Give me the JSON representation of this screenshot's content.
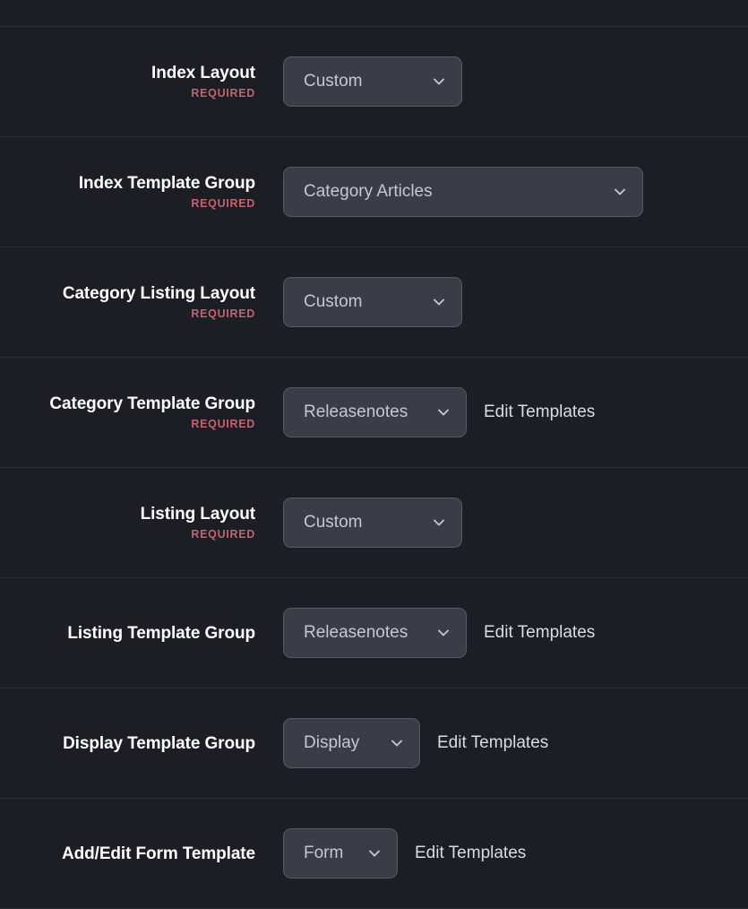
{
  "theme": {
    "background": "#1b1e25",
    "divider": "#2b2f38",
    "select_fill": "#383d48",
    "select_border": "#545a67",
    "label_color": "#ffffff",
    "required_color": "#c4636d",
    "value_color": "#c3c8d2",
    "link_color": "#d8dce3"
  },
  "form": {
    "rows": [
      {
        "label": "Index Layout",
        "required_text": "REQUIRED",
        "select_value": "Custom",
        "icon": "chevron-down-icon",
        "link": null,
        "width_class": "w-custom"
      },
      {
        "label": "Index Template Group",
        "required_text": "REQUIRED",
        "select_value": "Category Articles",
        "icon": "chevron-down-icon",
        "link": null,
        "width_class": "w-wide"
      },
      {
        "label": "Category Listing Layout",
        "required_text": "REQUIRED",
        "select_value": "Custom",
        "icon": "chevron-down-icon",
        "link": null,
        "width_class": "w-custom"
      },
      {
        "label": "Category Template Group",
        "required_text": "REQUIRED",
        "select_value": "Releasenotes",
        "icon": "chevron-down-icon",
        "link": "Edit Templates",
        "width_class": "w-rel"
      },
      {
        "label": "Listing Layout",
        "required_text": "REQUIRED",
        "select_value": "Custom",
        "icon": "chevron-down-icon",
        "link": null,
        "width_class": "w-custom"
      },
      {
        "label": "Listing Template Group",
        "required_text": null,
        "select_value": "Releasenotes",
        "icon": "chevron-down-icon",
        "link": "Edit Templates",
        "width_class": "w-rel"
      },
      {
        "label": "Display Template Group",
        "required_text": null,
        "select_value": "Display",
        "icon": "chevron-down-icon",
        "link": "Edit Templates",
        "width_class": "w-disp"
      },
      {
        "label": "Add/Edit Form Template",
        "required_text": null,
        "select_value": "Form",
        "icon": "chevron-down-icon",
        "link": "Edit Templates",
        "width_class": "w-form"
      }
    ]
  }
}
